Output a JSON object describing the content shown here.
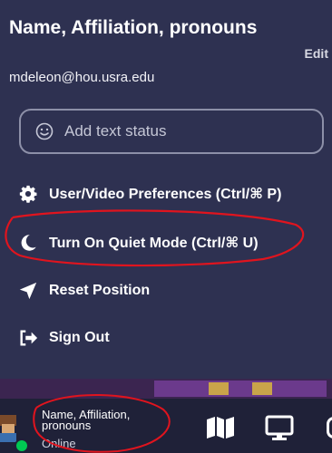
{
  "profile": {
    "name": "Name, Affiliation, pronouns",
    "edit_label": "Edit",
    "email": "mdeleon@hou.usra.edu"
  },
  "status": {
    "placeholder": "Add text status",
    "icon": "smile-icon"
  },
  "menu": {
    "items": [
      {
        "label": "User/Video Preferences (Ctrl/⌘ P)",
        "icon": "gear-icon"
      },
      {
        "label": "Turn On Quiet Mode (Ctrl/⌘ U)",
        "icon": "moon-icon"
      },
      {
        "label": "Reset Position",
        "icon": "navigation-arrow-icon"
      },
      {
        "label": "Sign Out",
        "icon": "sign-out-icon"
      }
    ]
  },
  "bottom_bar": {
    "name": "Name, Affiliation, pronouns",
    "presence": "Online",
    "icons": [
      "map-icon",
      "screen-share-icon"
    ]
  },
  "colors": {
    "panel": "#2e3151",
    "bar": "#1f2138",
    "online": "#00c853",
    "annotation": "#e0141e"
  }
}
